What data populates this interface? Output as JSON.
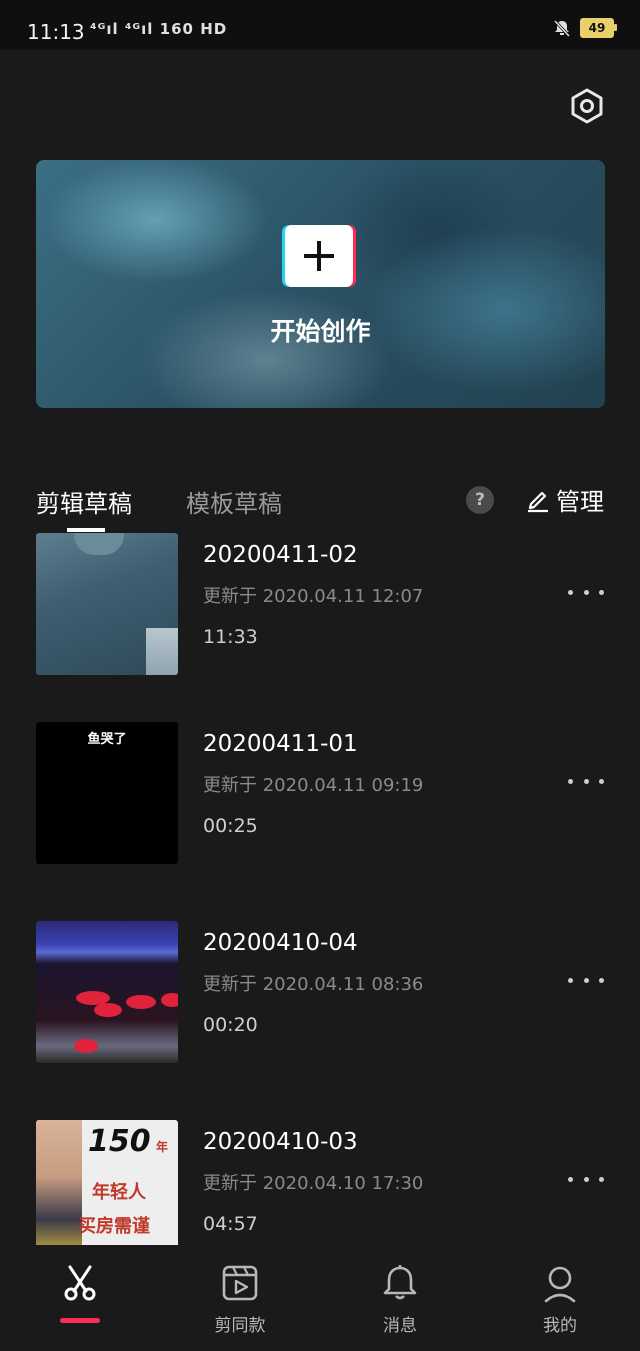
{
  "status_bar": {
    "time": "11:13",
    "indicators": "⁴ᴳıl ⁴ᴳıl 160 HD",
    "battery": "49"
  },
  "banner": {
    "label": "开始创作"
  },
  "tabs": {
    "active": "剪辑草稿",
    "inactive": "模板草稿",
    "help": "?",
    "manage": "管理"
  },
  "drafts": [
    {
      "title": "20200411-02",
      "updated": "更新于 2020.04.11 12:07",
      "duration": "11:33"
    },
    {
      "title": "20200411-01",
      "updated": "更新于 2020.04.11 09:19",
      "duration": "00:25",
      "thumb_caption": "鱼哭了"
    },
    {
      "title": "20200410-04",
      "updated": "更新于 2020.04.11 08:36",
      "duration": "00:20"
    },
    {
      "title": "20200410-03",
      "updated": "更新于 2020.04.10 17:30",
      "duration": "04:57",
      "thumb_text": {
        "big": "150",
        "small": "年",
        "line1": "年轻人",
        "line2": "买房需谨"
      }
    }
  ],
  "nav": [
    {
      "label": "",
      "icon": "scissors-icon",
      "active": true
    },
    {
      "label": "剪同款",
      "icon": "clapper-play-icon"
    },
    {
      "label": "消息",
      "icon": "bell-icon"
    },
    {
      "label": "我的",
      "icon": "person-icon"
    }
  ],
  "colors": {
    "background": "#1a1a1a",
    "accent": "#ff2d55",
    "accent_secondary": "#20d5ec",
    "battery": "#e8d16a"
  }
}
